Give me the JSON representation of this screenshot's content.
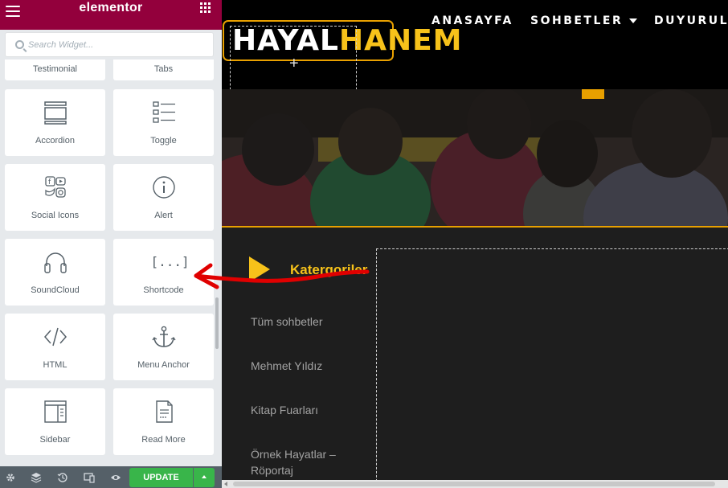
{
  "panel": {
    "title": "elementor",
    "search": {
      "placeholder": "Search Widget..."
    },
    "widgets": [
      {
        "label": "Testimonial",
        "icon": "testimonial-icon"
      },
      {
        "label": "Tabs",
        "icon": "tabs-icon"
      },
      {
        "label": "Accordion",
        "icon": "accordion-icon"
      },
      {
        "label": "Toggle",
        "icon": "toggle-icon"
      },
      {
        "label": "Social Icons",
        "icon": "social-icons-icon"
      },
      {
        "label": "Alert",
        "icon": "alert-icon"
      },
      {
        "label": "SoundCloud",
        "icon": "headphones-icon"
      },
      {
        "label": "Shortcode",
        "icon": "shortcode-icon",
        "icon_text": "[...]"
      },
      {
        "label": "HTML",
        "icon": "code-icon"
      },
      {
        "label": "Menu Anchor",
        "icon": "anchor-icon"
      },
      {
        "label": "Sidebar",
        "icon": "sidebar-icon"
      },
      {
        "label": "Read More",
        "icon": "read-more-icon"
      }
    ],
    "footer": {
      "update_label": "UPDATE"
    }
  },
  "site": {
    "logo": {
      "part1": "HAYAL",
      "part2": "HANEM"
    },
    "add_symbol": "+",
    "nav": [
      {
        "label": "ANASAYFA"
      },
      {
        "label": "SOHBETLER",
        "has_dropdown": true
      },
      {
        "label": "DUYURULAR"
      }
    ],
    "categories_title": "Katergoriler",
    "categories": [
      "Tüm sohbetler",
      "Mehmet Yıldız",
      "Kitap Fuarları",
      "Örnek Hayatlar – Röportaj"
    ]
  },
  "colors": {
    "elementor_header": "#93003c",
    "accent": "#f7c21a",
    "update_button": "#39b54a",
    "annotation_arrow": "#e00000"
  }
}
